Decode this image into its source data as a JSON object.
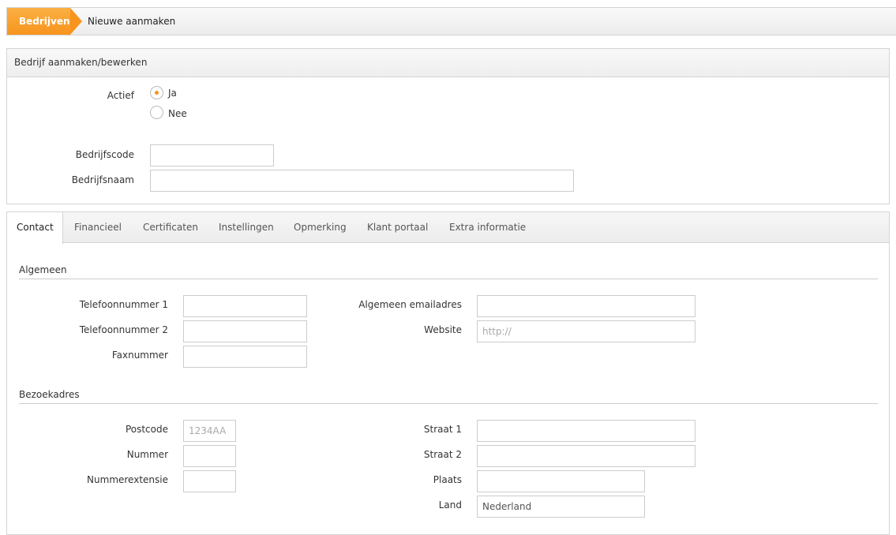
{
  "breadcrumb": {
    "active": "Bedrijven",
    "current": "Nieuwe aanmaken"
  },
  "company_panel": {
    "title": "Bedrijf aanmaken/bewerken",
    "actief_label": "Actief",
    "options": [
      {
        "label": "Ja",
        "selected": true
      },
      {
        "label": "Nee",
        "selected": false
      }
    ],
    "bedrijfscode_label": "Bedrijfscode",
    "bedrijfscode_value": "",
    "bedrijfsnaam_label": "Bedrijfsnaam",
    "bedrijfsnaam_value": ""
  },
  "tabs": [
    {
      "label": "Contact",
      "active": true
    },
    {
      "label": "Financieel",
      "active": false
    },
    {
      "label": "Certificaten",
      "active": false
    },
    {
      "label": "Instellingen",
      "active": false
    },
    {
      "label": "Opmerking",
      "active": false
    },
    {
      "label": "Klant portaal",
      "active": false
    },
    {
      "label": "Extra informatie",
      "active": false
    }
  ],
  "algemeen": {
    "title": "Algemeen",
    "telefoon1_label": "Telefoonnummer 1",
    "telefoon2_label": "Telefoonnummer 2",
    "fax_label": "Faxnummer",
    "email_label": "Algemeen emailadres",
    "website_label": "Website",
    "website_placeholder": "http://"
  },
  "bezoekadres": {
    "title": "Bezoekadres",
    "postcode_label": "Postcode",
    "postcode_placeholder": "1234AA",
    "nummer_label": "Nummer",
    "nummerextensie_label": "Nummerextensie",
    "straat1_label": "Straat 1",
    "straat2_label": "Straat 2",
    "plaats_label": "Plaats",
    "land_label": "Land",
    "land_value": "Nederland"
  },
  "colors": {
    "accent": "#f7941d",
    "border": "#d4d4d4"
  }
}
